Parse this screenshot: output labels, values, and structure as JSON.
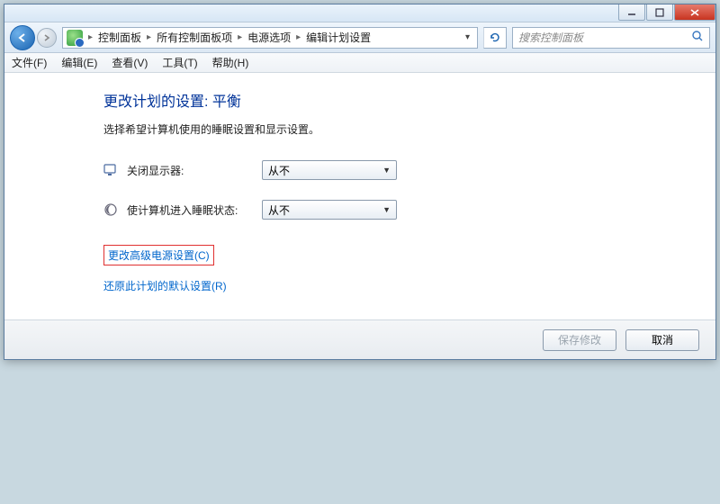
{
  "titlebar": {
    "minimize": "minimize",
    "maximize": "maximize",
    "close": "close"
  },
  "address": {
    "crumbs": [
      "控制面板",
      "所有控制面板项",
      "电源选项",
      "编辑计划设置"
    ]
  },
  "search": {
    "placeholder": "搜索控制面板"
  },
  "menu": {
    "file": "文件(F)",
    "edit": "编辑(E)",
    "view": "查看(V)",
    "tools": "工具(T)",
    "help": "帮助(H)"
  },
  "page": {
    "title": "更改计划的设置: 平衡",
    "description": "选择希望计算机使用的睡眠设置和显示设置。"
  },
  "settings": {
    "display_off": {
      "label": "关闭显示器:",
      "value": "从不"
    },
    "sleep": {
      "label": "使计算机进入睡眠状态:",
      "value": "从不"
    }
  },
  "links": {
    "advanced": "更改高级电源设置(C)",
    "restore": "还原此计划的默认设置(R)"
  },
  "footer": {
    "save": "保存修改",
    "cancel": "取消"
  }
}
